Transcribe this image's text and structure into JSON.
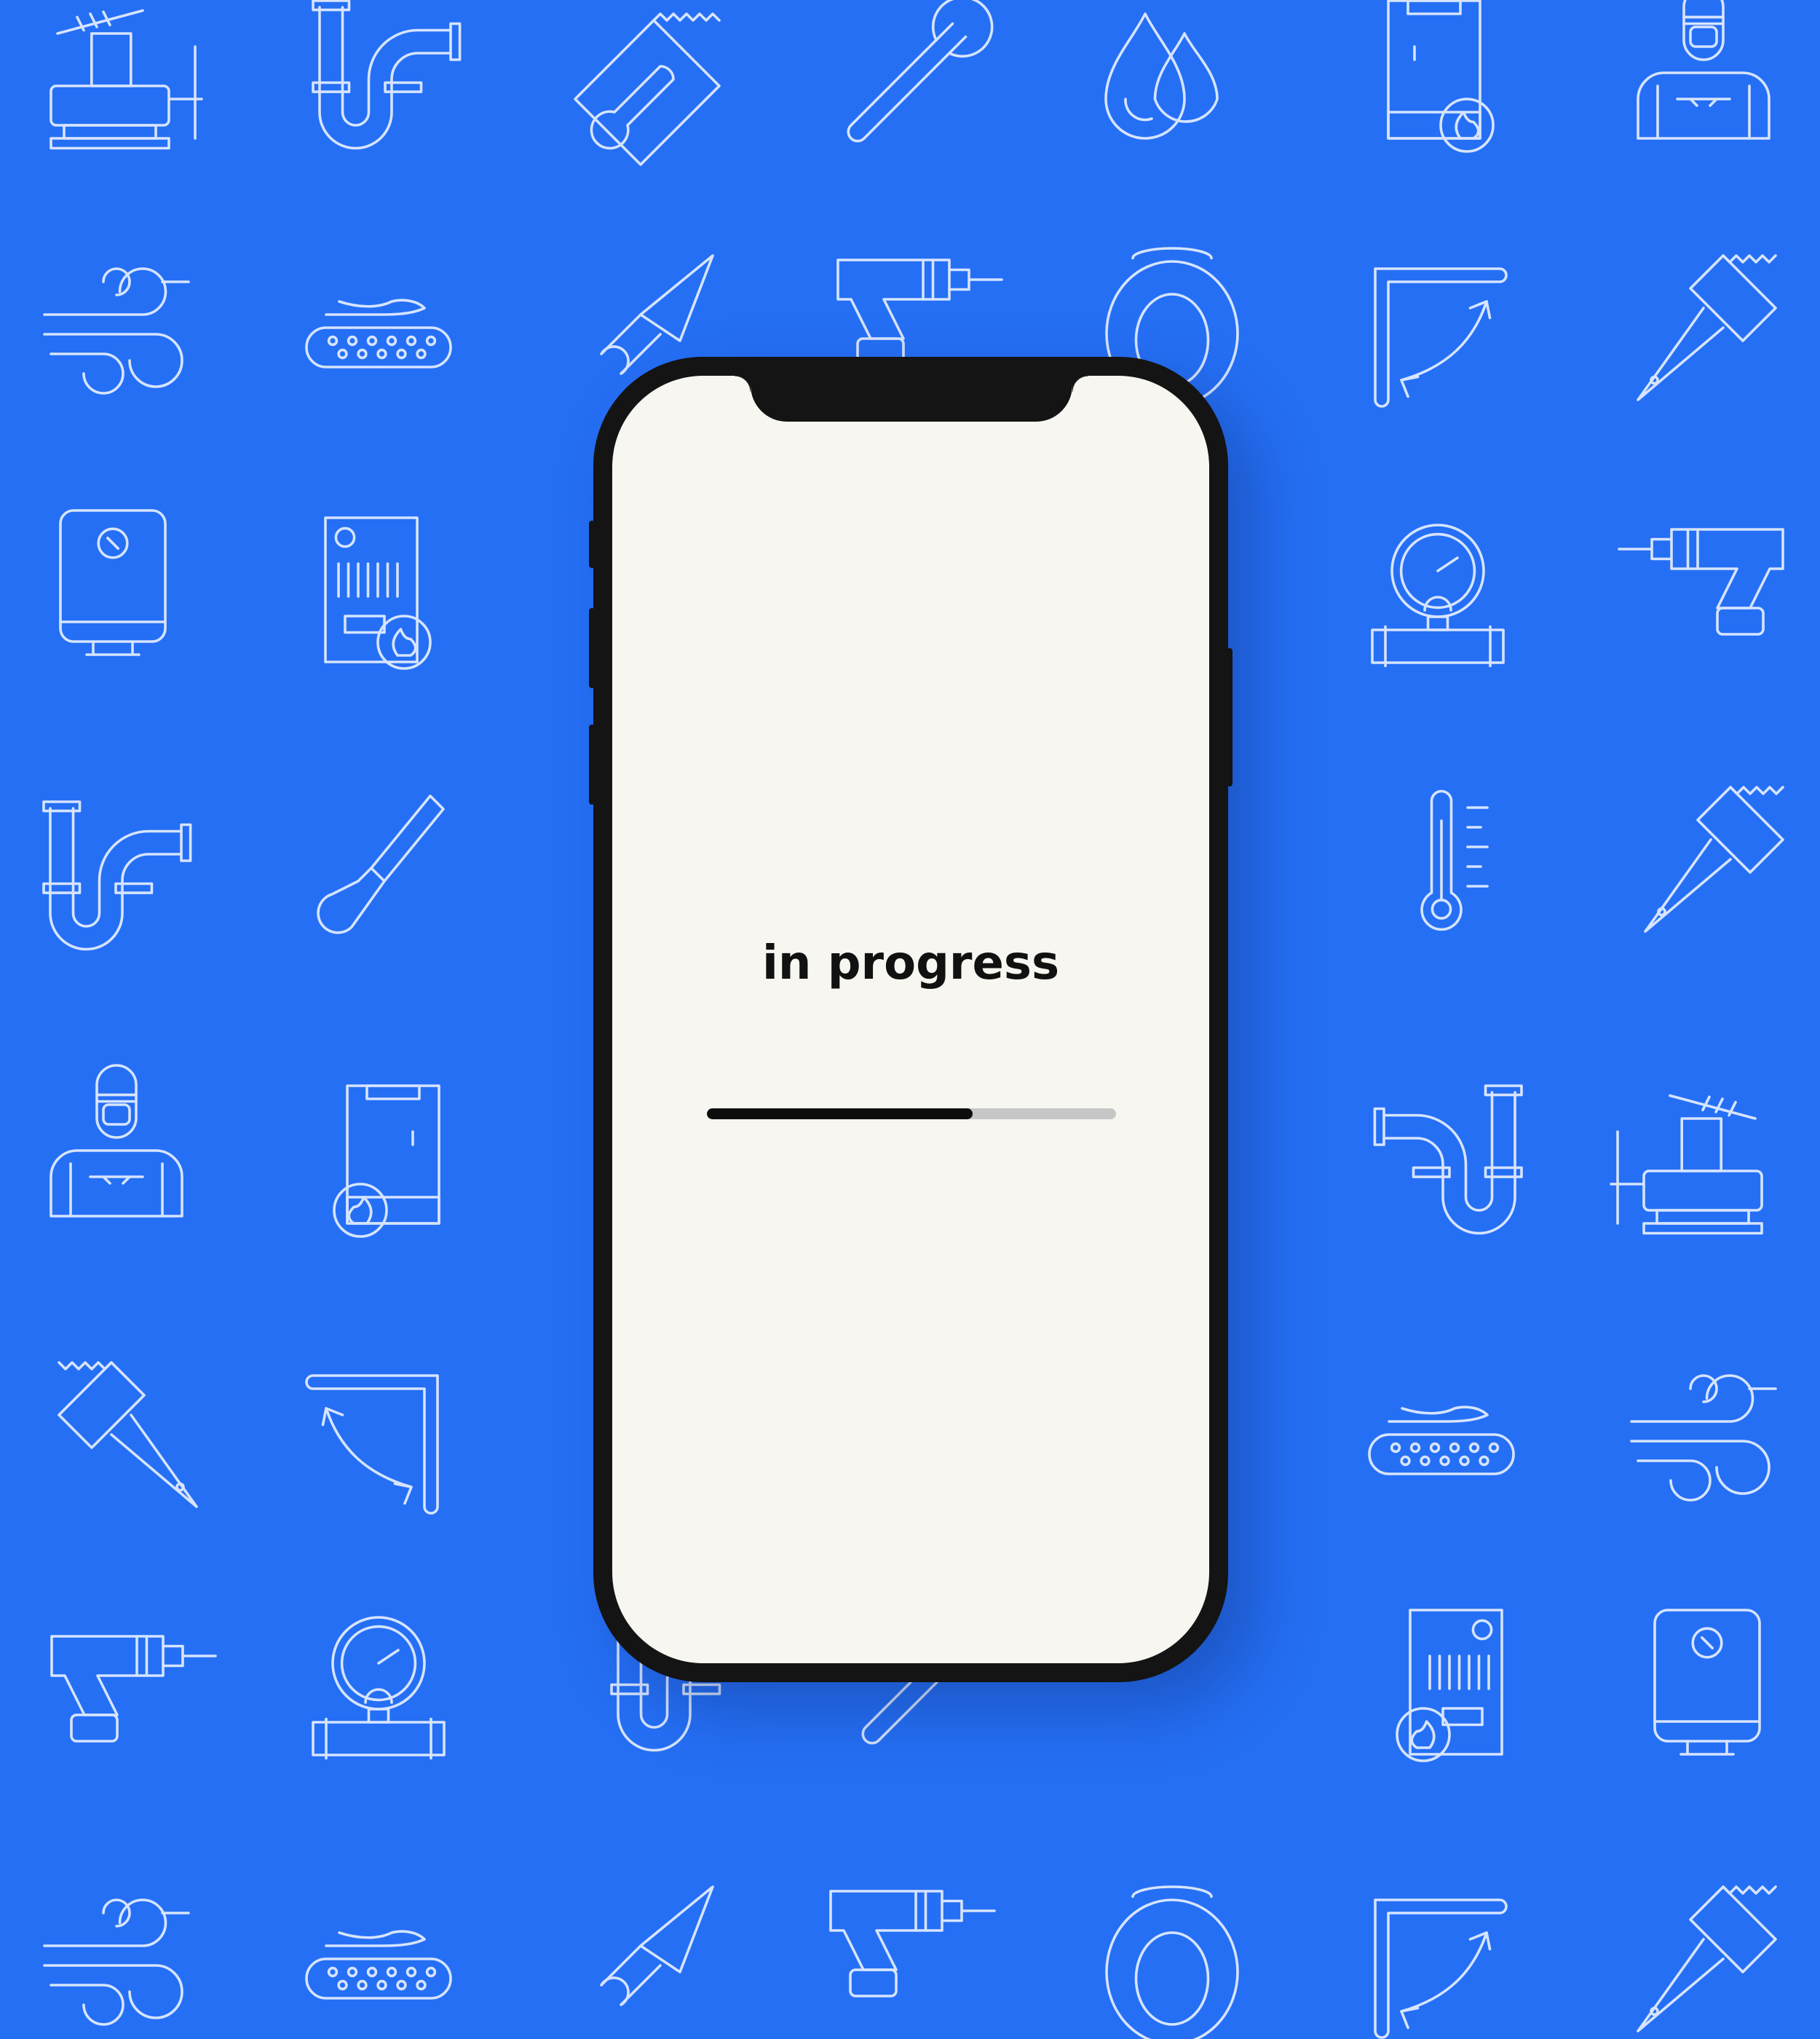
{
  "background": {
    "color": "#256ff5",
    "pattern_stroke": "#d6e4ff",
    "pattern_icons": [
      "vise-icon",
      "pipe-trap-icon",
      "tile-trowel-icon",
      "wrench-icon",
      "water-drops-icon",
      "boiler-icon",
      "plumber-icon",
      "wind-icon",
      "heated-floor-icon",
      "trowel-icon",
      "drill-icon",
      "toilet-icon",
      "shower-enclosure-icon",
      "paint-brush-icon",
      "water-heater-icon",
      "gas-boiler-icon",
      "pressure-gauge-icon",
      "thermometer-icon",
      "chisel-icon"
    ]
  },
  "status": {
    "text": "in progress"
  },
  "progress": {
    "value": 0.65,
    "fill_color": "#0d0d0d",
    "track_color": "#c6c6c6"
  }
}
